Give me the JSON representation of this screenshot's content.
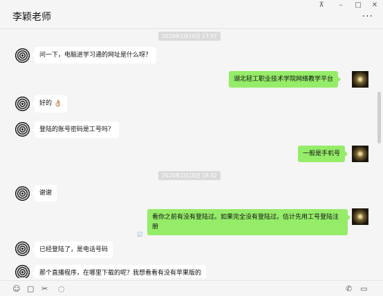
{
  "window": {
    "title": "李颖老师",
    "controls": {
      "pin": "⊼",
      "minimize": "–",
      "maximize": "□",
      "close": "✕"
    },
    "more": "···"
  },
  "messages": {
    "ts1": "2020年2月10日 17:57",
    "m1": "问一下，电脑进学习通的网址是什么呀？",
    "m2": "湖北轻工职业技术学院网络教学平台",
    "m3": "好的",
    "m3_emoji": "👌🏼",
    "m4": "登陆的账号密码是工号吗？",
    "m5": "一般是手机号",
    "ts2": "2020年2月10日 18:02",
    "m6": "谢谢",
    "m7": "看你之前有没有登陆过。如果完全没有登陆过。估计先用工号登陆注册",
    "m8": "已经登陆了，是电话号码",
    "m9": "那个直播程序，在哪里下载的呢？我想看看有没有苹果版的"
  },
  "toolbar": {
    "emoji_icon": "☺",
    "folder_icon": "▢",
    "scissors_icon": "✂",
    "chat_icon": "◌",
    "phone_icon": "✆",
    "video_icon": "▭"
  },
  "colors": {
    "incoming": "#ffffff",
    "outgoing": "#95ec69",
    "background": "#f5f5f5"
  }
}
